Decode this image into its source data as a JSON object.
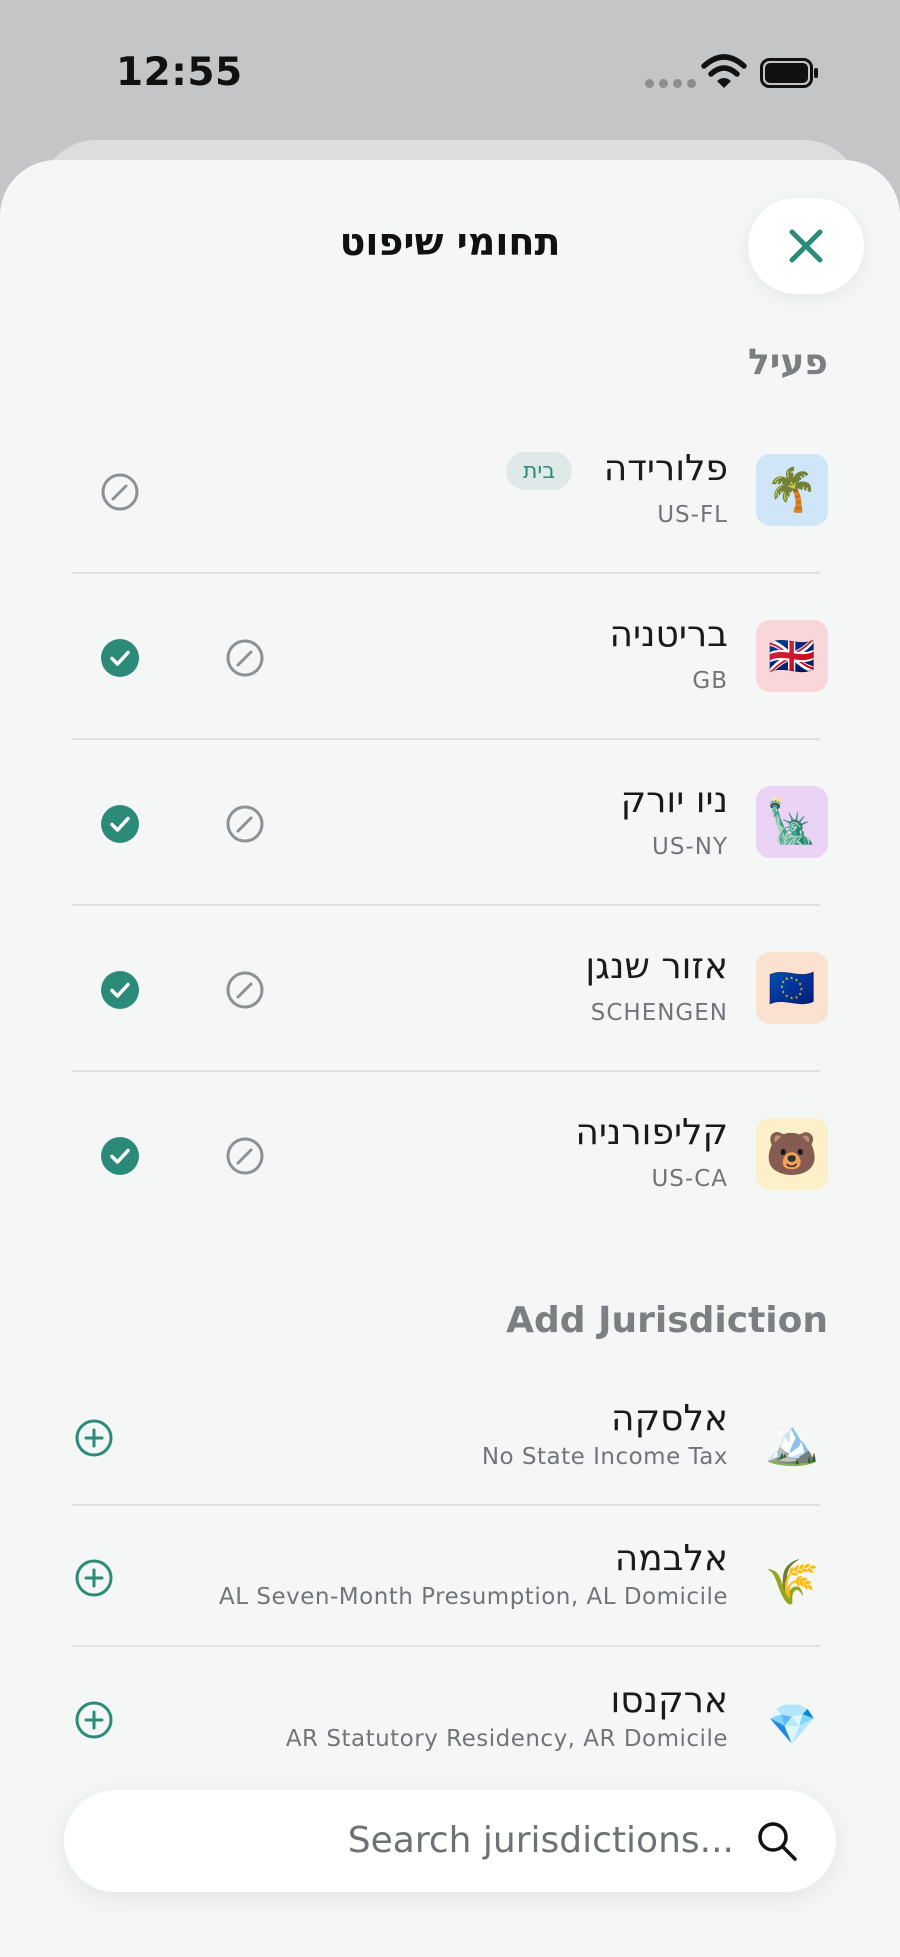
{
  "status_bar": {
    "time": "12:55"
  },
  "header": {
    "title": "תחומי שיפוט"
  },
  "active_section": {
    "label": "פעיל",
    "items": [
      {
        "name": "פלורידה",
        "code": "US-FL",
        "badge": "בית",
        "icon": "🌴",
        "icon_name": "palm-tree-icon",
        "tile_color": "#cfe6f9",
        "selected": false
      },
      {
        "name": "בריטניה",
        "code": "GB",
        "icon": "🇬🇧",
        "icon_name": "uk-flag-icon",
        "tile_color": "#f9d6d9",
        "selected": true
      },
      {
        "name": "ניו יורק",
        "code": "US-NY",
        "icon": "🗽",
        "icon_name": "statue-of-liberty-icon",
        "tile_color": "#ead3f4",
        "selected": true
      },
      {
        "name": "אזור שנגן",
        "code": "SCHENGEN",
        "icon": "🇪🇺",
        "icon_name": "eu-flag-icon",
        "tile_color": "#fbe2d0",
        "selected": true
      },
      {
        "name": "קליפורניה",
        "code": "US-CA",
        "icon": "🐻",
        "icon_name": "bear-icon",
        "tile_color": "#fbf0c8",
        "selected": true
      }
    ]
  },
  "add_section": {
    "label": "Add Jurisdiction",
    "items": [
      {
        "name": "אלסקה",
        "detail": "No State Income Tax",
        "icon": "🏔️",
        "icon_name": "mountain-icon"
      },
      {
        "name": "אלבמה",
        "detail": "AL Seven-Month Presumption, AL Domicile",
        "icon": "🌾",
        "icon_name": "wheat-icon"
      },
      {
        "name": "ארקנסו",
        "detail": "AR Statutory Residency, AR Domicile",
        "icon": "💎",
        "icon_name": "diamond-icon"
      }
    ]
  },
  "search": {
    "placeholder": "Search jurisdictions..."
  },
  "colors": {
    "accent": "#2b8b78",
    "background": "#f5f7f7",
    "muted": "#7b7f82"
  }
}
